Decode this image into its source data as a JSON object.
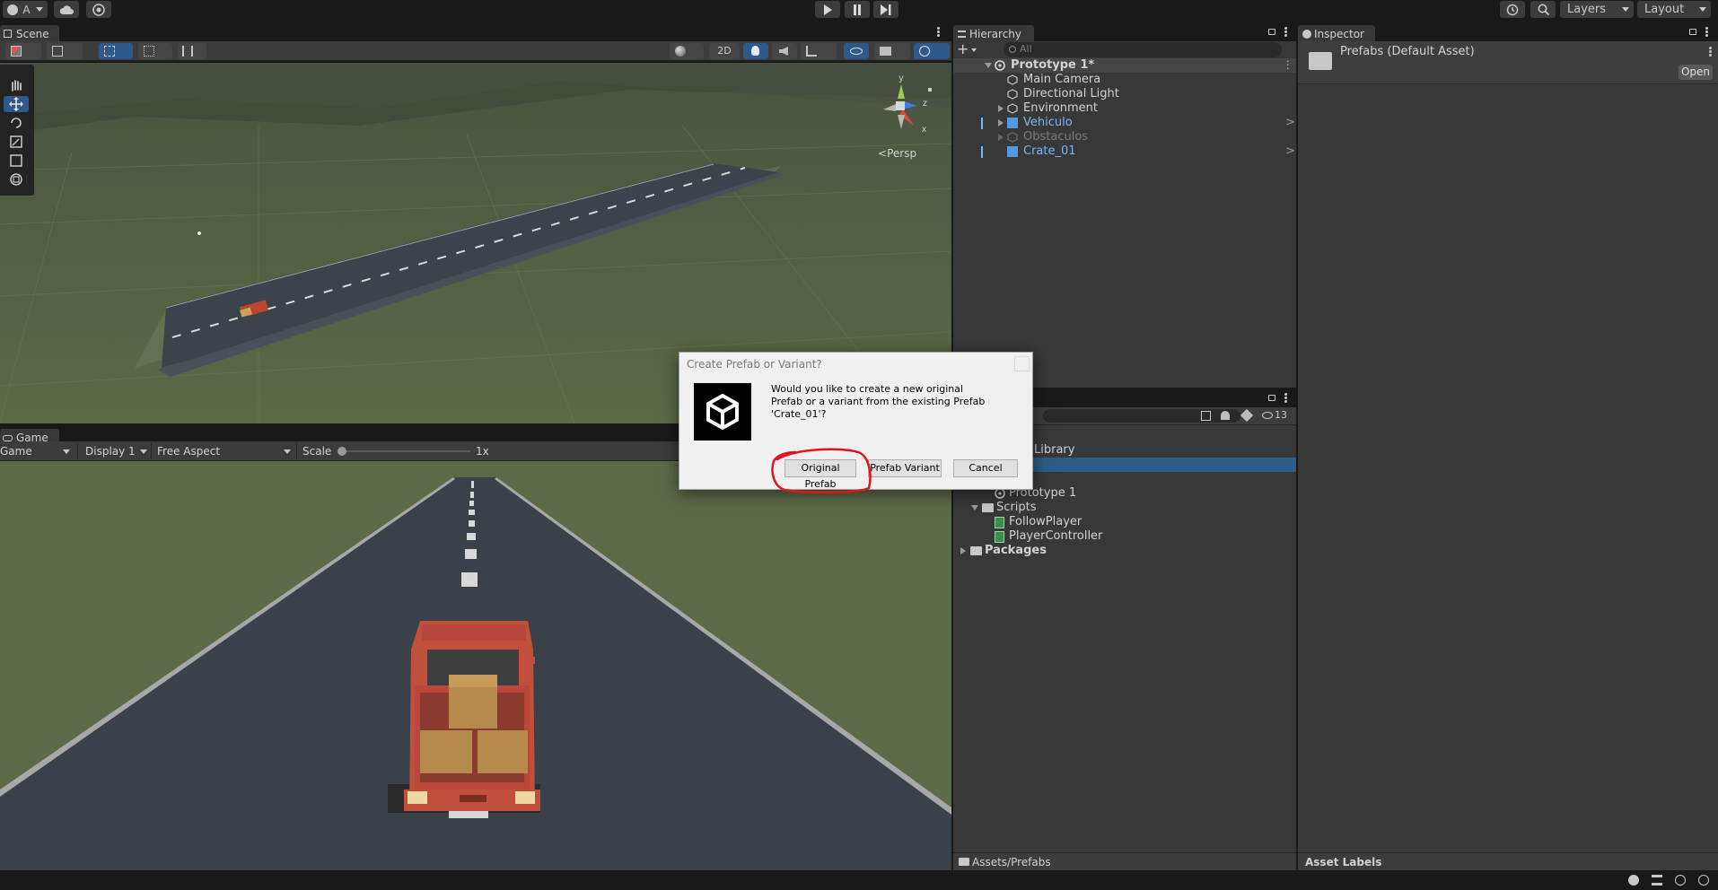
{
  "toolbar": {
    "account_label": "A",
    "layers_label": "Layers",
    "layout_label": "Layout"
  },
  "scene": {
    "tab_label": "Scene",
    "mode_2d_label": "2D",
    "persp_label": "Persp",
    "gizmo_axes": {
      "y": "y",
      "z": "z",
      "x": "x"
    }
  },
  "game": {
    "tab_label": "Game",
    "mode_select": "Game",
    "display_select": "Display 1",
    "aspect_select": "Free Aspect",
    "scale_label": "Scale",
    "scale_value": "1x"
  },
  "hierarchy": {
    "tab_label": "Hierarchy",
    "search_placeholder": "All",
    "scene_name": "Prototype 1*",
    "items": [
      {
        "label": "Main Camera"
      },
      {
        "label": "Directional Light"
      },
      {
        "label": "Environment"
      },
      {
        "label": "Vehiculo"
      },
      {
        "label": "Obstaculos"
      },
      {
        "label": "Crate_01"
      }
    ]
  },
  "inspector": {
    "tab_label": "Inspector",
    "asset_title": "Prefabs (Default Asset)",
    "open_label": "Open",
    "asset_labels": "Asset Labels"
  },
  "project": {
    "hidden_count": "13",
    "items": [
      {
        "label": "Library"
      },
      {
        "label": "Prototype 1"
      },
      {
        "label": "Scripts"
      },
      {
        "label": "FollowPlayer"
      },
      {
        "label": "PlayerController"
      },
      {
        "label": "Packages"
      }
    ],
    "path": "Assets/Prefabs"
  },
  "dialog": {
    "title": "Create Prefab or Variant?",
    "message": "Would you like to create a new original Prefab or a variant from the existing Prefab 'Crate_01'?",
    "original_label": "Original Prefab",
    "variant_label": "Prefab Variant",
    "cancel_label": "Cancel"
  },
  "colors": {
    "accent_blue": "#2c5d87",
    "prefab_blue": "#7fb8ef",
    "annotation_red": "#e0141e",
    "ground_green": "#5d6a47"
  }
}
